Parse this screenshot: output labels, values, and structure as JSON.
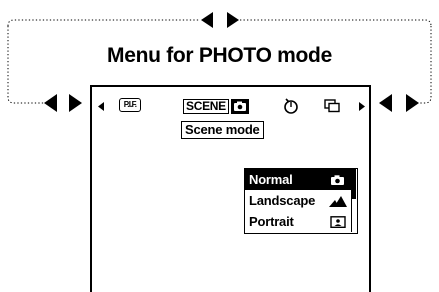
{
  "diagram_title": "Menu for PHOTO mode",
  "menu_bar": {
    "pf_icon_text": "P.I.F.",
    "scene_label": "SCENE",
    "left_arrow_icon": "triangle-left",
    "right_arrow_icon": "triangle-right",
    "selftimer_icon": "self-timer",
    "burst_icon": "continuous-shooting"
  },
  "tooltip": "Scene mode",
  "scene_list": {
    "items": [
      {
        "label": "Normal",
        "icon": "camera",
        "selected": true
      },
      {
        "label": "Landscape",
        "icon": "mountains",
        "selected": false
      },
      {
        "label": "Portrait",
        "icon": "portrait",
        "selected": false
      }
    ]
  },
  "connector_arrows": [
    "left-right-arrows-top",
    "left-right-arrows-left",
    "left-right-arrows-right"
  ]
}
